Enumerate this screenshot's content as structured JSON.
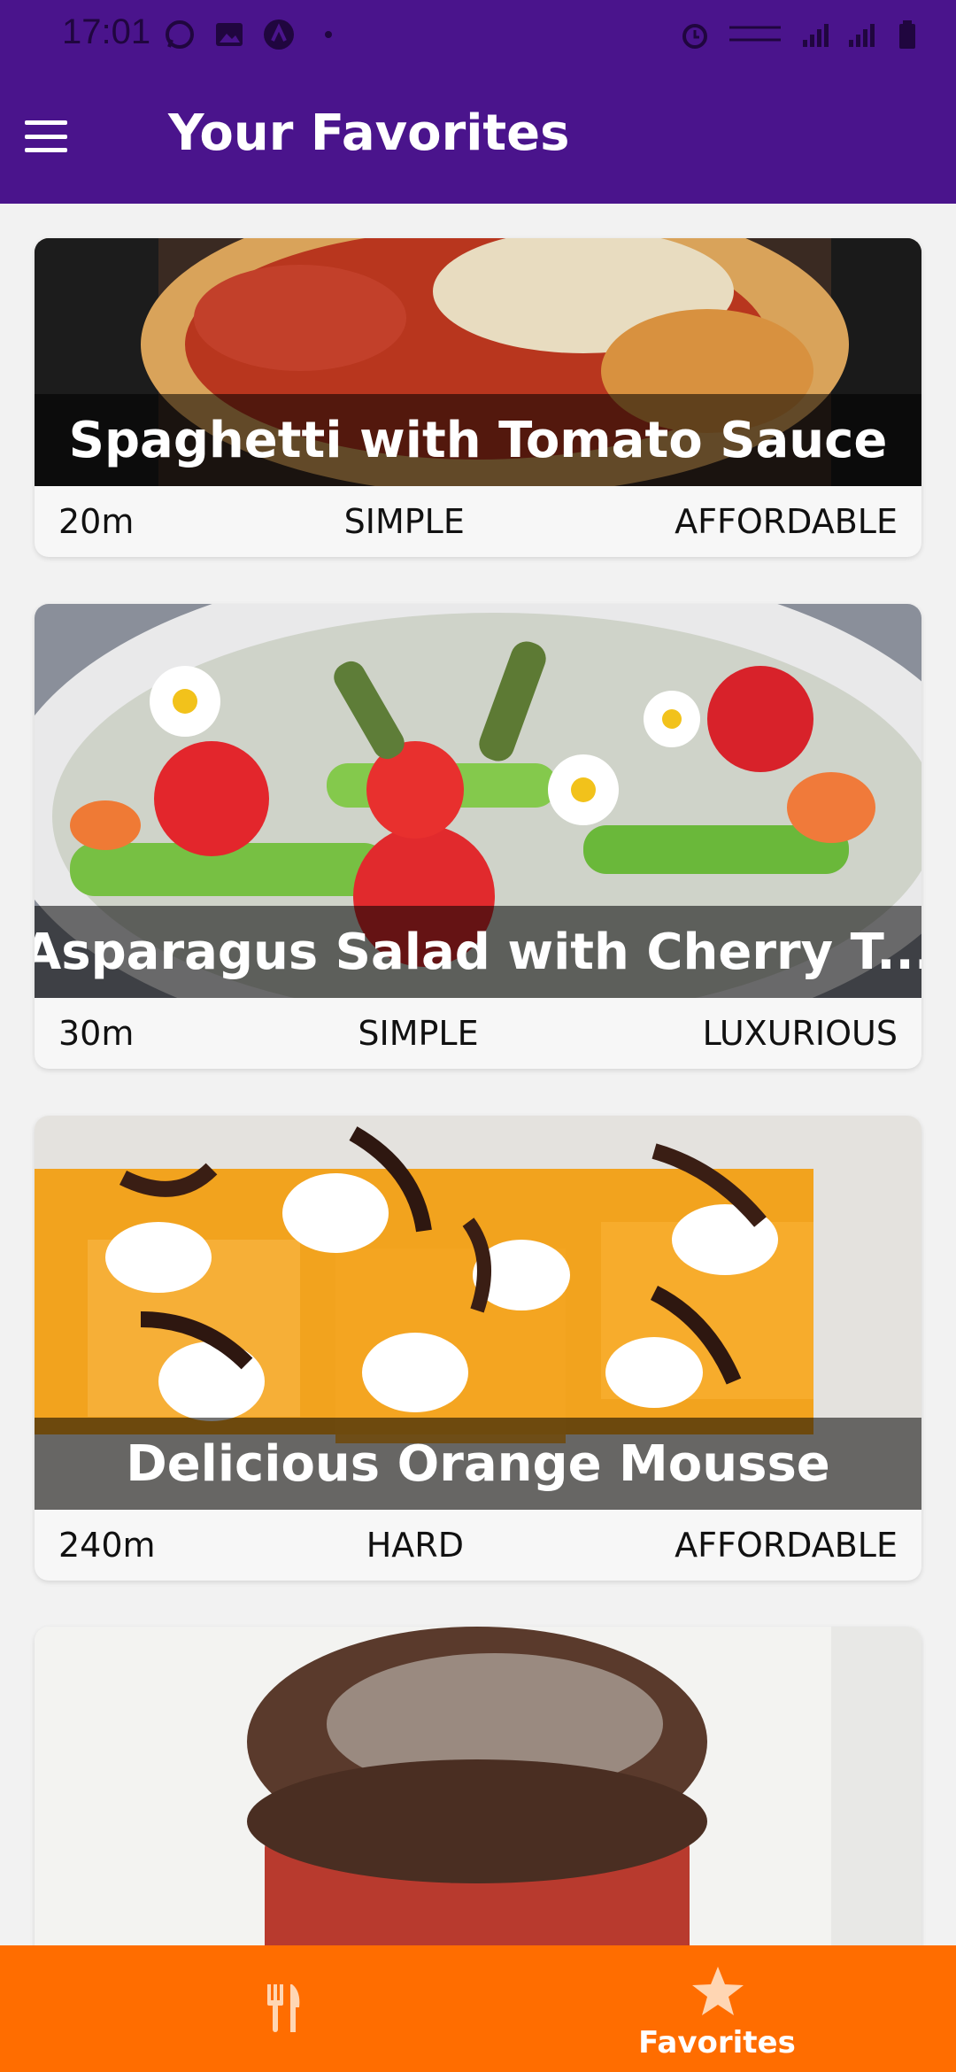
{
  "status_bar": {
    "time": "17:01",
    "left_icons": [
      "whatsapp-icon",
      "image-icon",
      "app-icon",
      "dot-icon"
    ],
    "right_icons": [
      "alarm-icon",
      "volte-lte-icon",
      "signal-icon",
      "signal-icon-2",
      "battery-icon"
    ]
  },
  "app_bar": {
    "title": "Your Favorites",
    "menu_icon": "hamburger-menu-icon"
  },
  "meals": [
    {
      "title": "Spaghetti with Tomato Sauce",
      "duration": "20m",
      "complexity": "SIMPLE",
      "affordability": "AFFORDABLE"
    },
    {
      "title": "Asparagus Salad with Cherry T...",
      "duration": "30m",
      "complexity": "SIMPLE",
      "affordability": "LUXURIOUS"
    },
    {
      "title": "Delicious Orange Mousse",
      "duration": "240m",
      "complexity": "HARD",
      "affordability": "AFFORDABLE"
    },
    {
      "title": "",
      "duration": "",
      "complexity": "",
      "affordability": ""
    }
  ],
  "bottom_nav": {
    "items": [
      {
        "icon": "restaurant-icon",
        "label": ""
      },
      {
        "icon": "star-icon",
        "label": "Favorites"
      }
    ]
  },
  "colors": {
    "primary": "#4a148c",
    "accent": "#ff6d00"
  }
}
